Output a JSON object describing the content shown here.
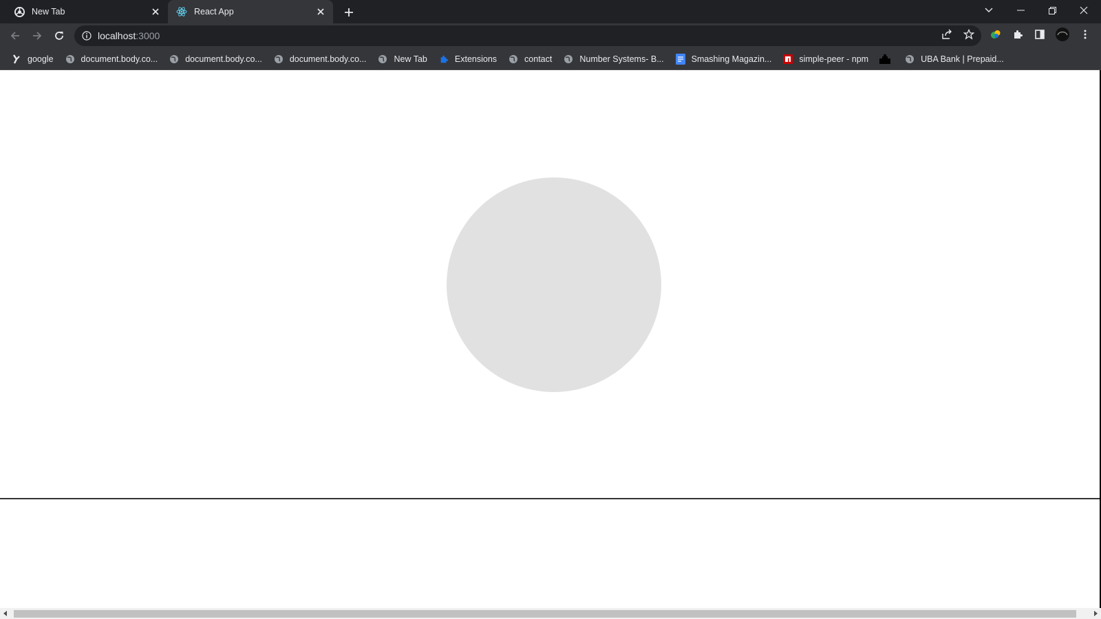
{
  "tabs": [
    {
      "title": "New Tab",
      "icon": "chrome-icon",
      "active": false
    },
    {
      "title": "React App",
      "icon": "react-icon",
      "active": true
    }
  ],
  "toolbar": {
    "url_host": "localhost",
    "url_port": ":3000"
  },
  "bookmarks": [
    {
      "label": "google",
      "icon": "google-bookmark-icon"
    },
    {
      "label": "document.body.co...",
      "icon": "globe-icon"
    },
    {
      "label": "document.body.co...",
      "icon": "globe-icon"
    },
    {
      "label": "document.body.co...",
      "icon": "globe-icon"
    },
    {
      "label": "New Tab",
      "icon": "globe-icon"
    },
    {
      "label": "Extensions",
      "icon": "puzzle-icon"
    },
    {
      "label": "contact",
      "icon": "globe-icon"
    },
    {
      "label": "Number Systems- B...",
      "icon": "globe-icon"
    },
    {
      "label": "Smashing Magazin...",
      "icon": "docs-icon"
    },
    {
      "label": "simple-peer - npm",
      "icon": "npm-icon"
    },
    {
      "label": "",
      "icon": "folder-icon"
    },
    {
      "label": "UBA Bank | Prepaid...",
      "icon": "globe-icon"
    }
  ],
  "colors": {
    "tabstrip": "#202124",
    "toolbar": "#35363a",
    "loader": "#e1e1e1"
  }
}
